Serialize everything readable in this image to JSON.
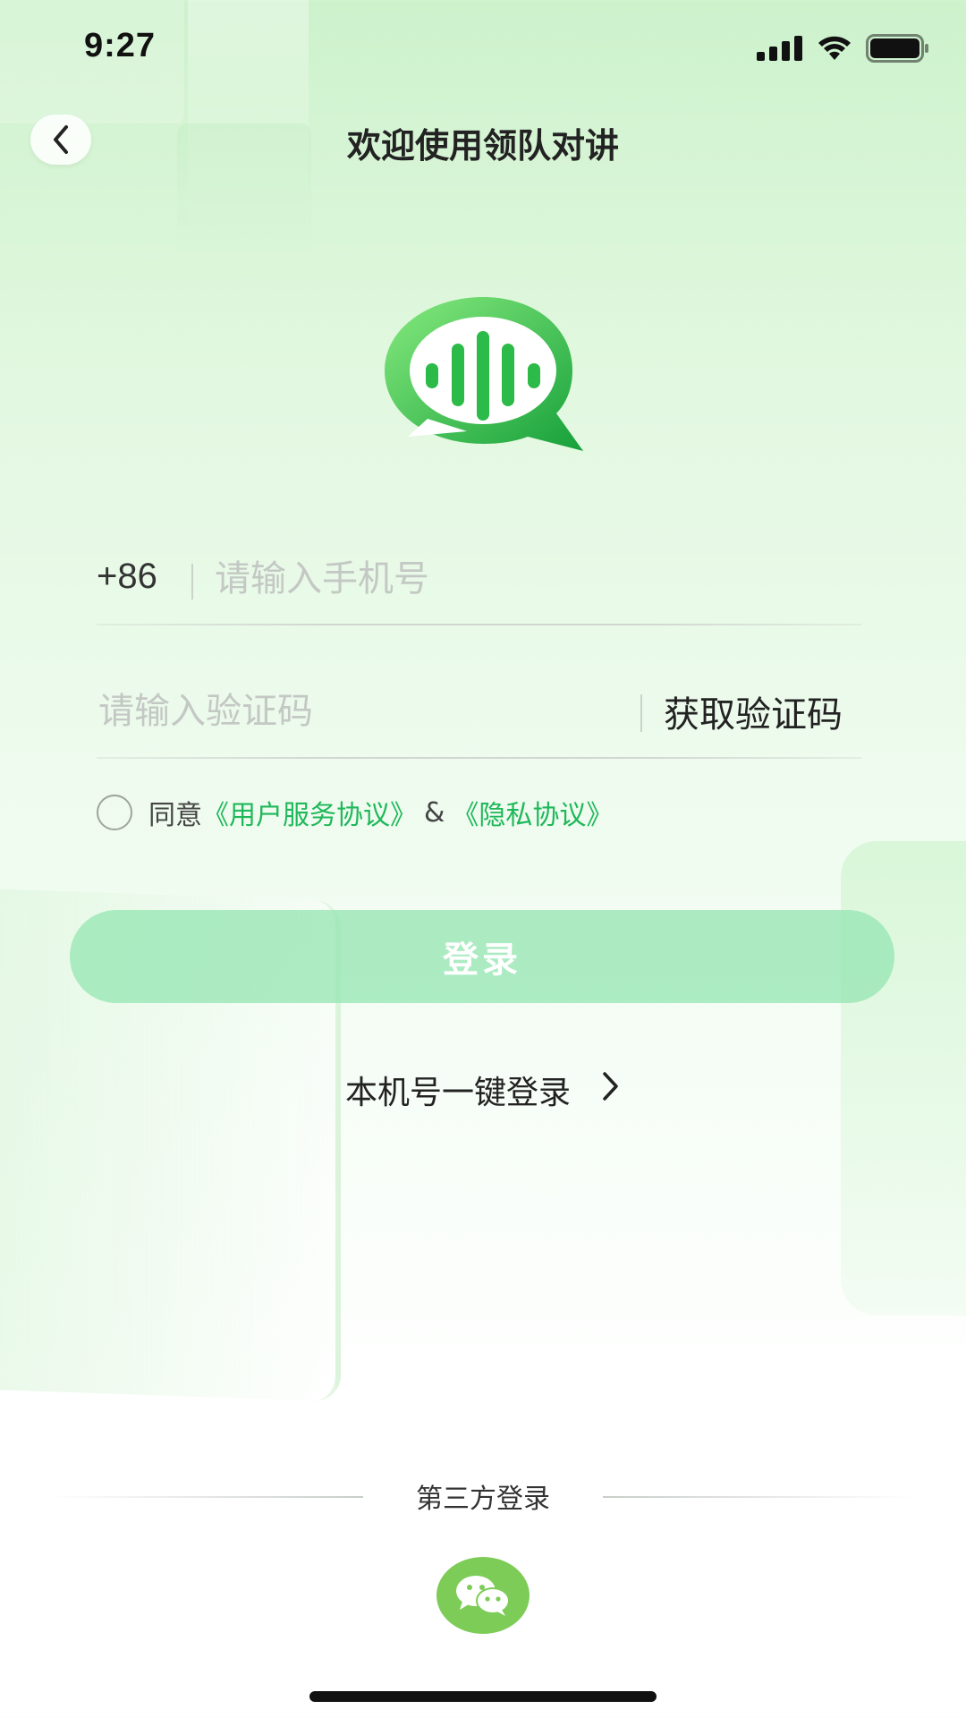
{
  "status_bar": {
    "time": "9:27",
    "signal_icon": "cellular-signal-icon",
    "wifi_icon": "wifi-icon",
    "battery_icon": "battery-icon"
  },
  "header": {
    "back_icon": "chevron-left-icon",
    "title": "欢迎使用领队对讲"
  },
  "logo": {
    "icon": "voice-chat-bubble-logo",
    "colors": {
      "light": "#7ee37a",
      "dark": "#1aa83c"
    }
  },
  "form": {
    "country_code": "+86",
    "phone_placeholder": "请输入手机号",
    "code_placeholder": "请输入验证码",
    "get_code_label": "获取验证码"
  },
  "agreement": {
    "prefix": "同意",
    "user_agreement": "《用户服务协议》",
    "amp": "&",
    "privacy": "《隐私协议》",
    "checked": false,
    "link_color": "#1fb85a"
  },
  "login_button": {
    "label": "登录",
    "color": "#94e6b2"
  },
  "one_key_login": {
    "label": "本机号一键登录",
    "icon": "chevron-right-icon"
  },
  "third_party": {
    "label": "第三方登录",
    "wechat_icon": "wechat-icon",
    "wechat_color": "#7dcc58"
  }
}
